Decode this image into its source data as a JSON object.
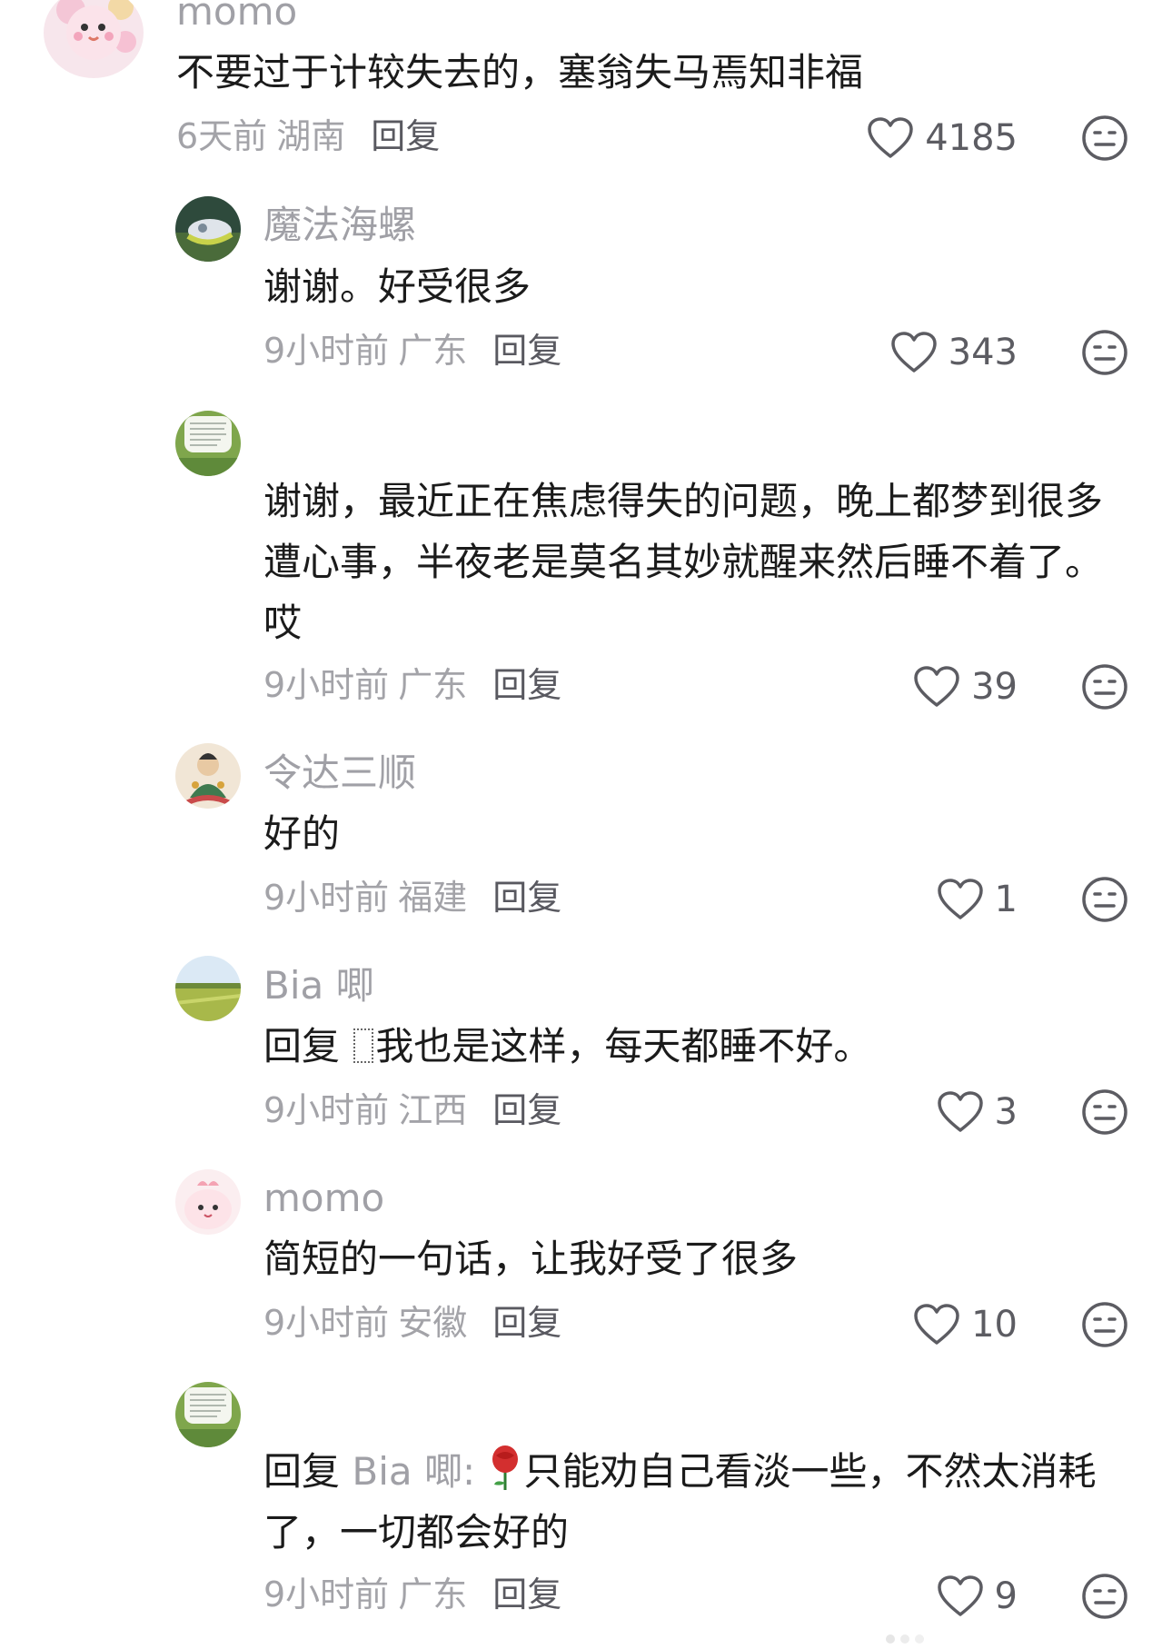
{
  "comments": [
    {
      "username": "momo",
      "text": "不要过于计较失去的，塞翁失马焉知非福",
      "time": "6天前",
      "location": "湖南",
      "reply_label": "回复",
      "likes": "4185",
      "avatar_icon": "pink-cartoon-avatar"
    },
    {
      "username": "魔法海螺",
      "text": "谢谢。好受很多",
      "time": "9小时前",
      "location": "广东",
      "reply_label": "回复",
      "likes": "343",
      "avatar_icon": "conch-shell-avatar"
    },
    {
      "username": "",
      "text": "谢谢，最近正在焦虑得失的问题，晚上都梦到很多遭心事，半夜老是莫名其妙就醒来然后睡不着了。哎",
      "time": "9小时前",
      "location": "广东",
      "reply_label": "回复",
      "likes": "39",
      "avatar_icon": "text-card-avatar"
    },
    {
      "username": "令达三顺",
      "text": "好的",
      "time": "9小时前",
      "location": "福建",
      "reply_label": "回复",
      "likes": "1",
      "avatar_icon": "buddha-painting-avatar"
    },
    {
      "username": "Bia 唧",
      "reply_prefix": "回复",
      "text": "我也是这样，每天都睡不好。",
      "time": "9小时前",
      "location": "江西",
      "reply_label": "回复",
      "likes": "3",
      "avatar_icon": "landscape-avatar"
    },
    {
      "username": "momo",
      "text": "简短的一句话，让我好受了很多",
      "time": "9小时前",
      "location": "安徽",
      "reply_label": "回复",
      "likes": "10",
      "avatar_icon": "pink-blob-avatar"
    },
    {
      "username": "",
      "reply_prefix": "回复",
      "reply_target": "Bia 唧:",
      "text": "只能劝自己看淡一些，不然太消耗了，一切都会好的",
      "time": "9小时前",
      "location": "广东",
      "reply_label": "回复",
      "likes": "9",
      "avatar_icon": "text-card-avatar"
    }
  ],
  "colors": {
    "username": "#a0a0a6",
    "body_text": "#1b1b1b",
    "meta_text": "#a3a3a8",
    "reply_link": "#595960",
    "icon_stroke": "#5c5c62"
  }
}
